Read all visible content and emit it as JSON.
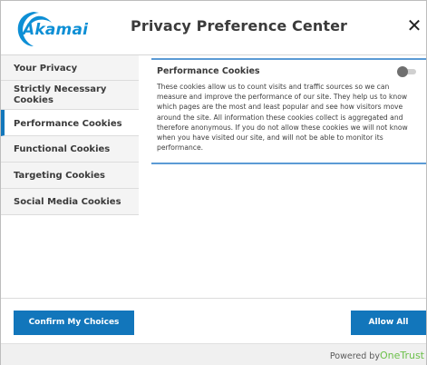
{
  "header": {
    "logo_text": "Akamai",
    "title": "Privacy Preference Center",
    "close_glyph": "✕",
    "brand_color": "#0d8fd5"
  },
  "sidebar": {
    "items": [
      {
        "label": "Your Privacy",
        "active": false
      },
      {
        "label": "Strictly Necessary Cookies",
        "active": false
      },
      {
        "label": "Performance Cookies",
        "active": true
      },
      {
        "label": "Functional Cookies",
        "active": false
      },
      {
        "label": "Targeting Cookies",
        "active": false
      },
      {
        "label": "Social Media Cookies",
        "active": false
      }
    ]
  },
  "content": {
    "title": "Performance Cookies",
    "toggle_on": false,
    "description": "These cookies allow us to count visits and traffic sources so we can measure and improve the performance of our site. They help us to know which pages are the most and least popular and see how visitors move around the site.  All information these cookies collect is aggregated and therefore anonymous. If you do not allow these cookies we will not know when you have visited our site, and will not be able to monitor its performance."
  },
  "footer": {
    "confirm_label": "Confirm My Choices",
    "allow_all_label": "Allow All",
    "powered_by": "Powered by",
    "powered_brand": "OneTrust",
    "button_color": "#1276bb"
  }
}
